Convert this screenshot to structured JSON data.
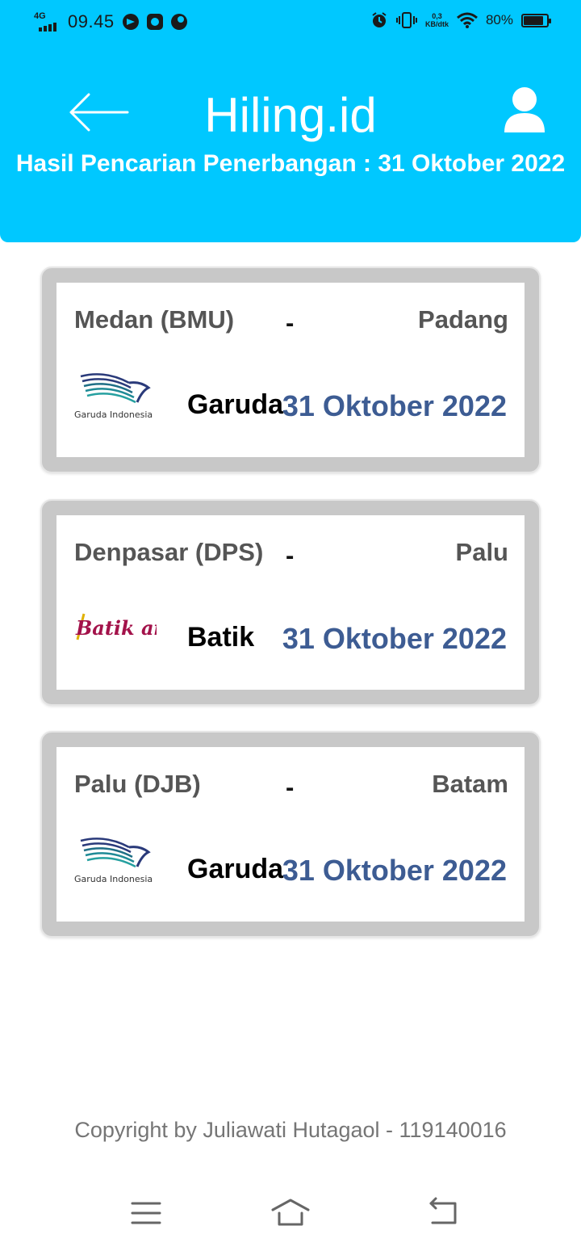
{
  "status_bar": {
    "network": "4G",
    "time": "09.45",
    "speed_value": "0,3",
    "speed_unit": "KB/dtk",
    "battery": "80%",
    "battery_level": 0.8,
    "icons": [
      "telegram-icon",
      "instagram-icon",
      "app-icon",
      "alarm-icon",
      "vibrate-icon",
      "wifi-icon",
      "battery-icon"
    ]
  },
  "header": {
    "title": "Hiling.id",
    "subtitle": "Hasil Pencarian Penerbangan : 31 Oktober 2022",
    "background": "#00c8ff",
    "back_icon": "arrow-left-icon",
    "profile_icon": "user-icon"
  },
  "flights": [
    {
      "origin": "Medan (BMU)",
      "separator": "-",
      "destination": "Padang",
      "logo_text": "Garuda Indonesia",
      "airline": "Garuda",
      "date": "31 Oktober 2022"
    },
    {
      "origin": "Denpasar (DPS)",
      "separator": "-",
      "destination": "Palu",
      "logo_text": "Batik air",
      "airline": "Batik",
      "date": "31 Oktober 2022"
    },
    {
      "origin": "Palu (DJB)",
      "separator": "-",
      "destination": "Batam",
      "logo_text": "Garuda Indonesia",
      "airline": "Garuda",
      "date": "31 Oktober 2022"
    }
  ],
  "colors": {
    "date_text": "#3d5c93",
    "card_frame": "#c8c8c8"
  },
  "footer": {
    "copyright": "Copyright by Juliawati Hutagaol - 119140016"
  },
  "nav": {
    "icons": [
      "menu-icon",
      "home-icon",
      "back-icon"
    ]
  }
}
